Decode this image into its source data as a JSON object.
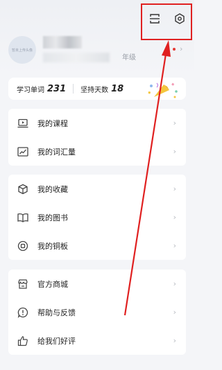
{
  "profile": {
    "avatar_text": "暂未上传头像",
    "grade_label": "年级",
    "chevron": "›"
  },
  "stats": {
    "words_label": "学习单词",
    "words_value": "231",
    "days_label": "坚持天数",
    "days_value": "18"
  },
  "menu1": [
    {
      "label": "我的课程",
      "icon": "laptop-icon"
    },
    {
      "label": "我的词汇量",
      "icon": "chart-icon"
    }
  ],
  "menu2": [
    {
      "label": "我的收藏",
      "icon": "cube-icon"
    },
    {
      "label": "我的图书",
      "icon": "book-icon"
    },
    {
      "label": "我的铜板",
      "icon": "coin-icon"
    }
  ],
  "menu3": [
    {
      "label": "官方商城",
      "icon": "shop-icon"
    },
    {
      "label": "帮助与反馈",
      "icon": "help-icon"
    },
    {
      "label": "给我们好评",
      "icon": "thumbs-up-icon"
    }
  ],
  "chevron": "›",
  "colors": {
    "accent": "#e02020",
    "icon": "#3a7bd5"
  }
}
